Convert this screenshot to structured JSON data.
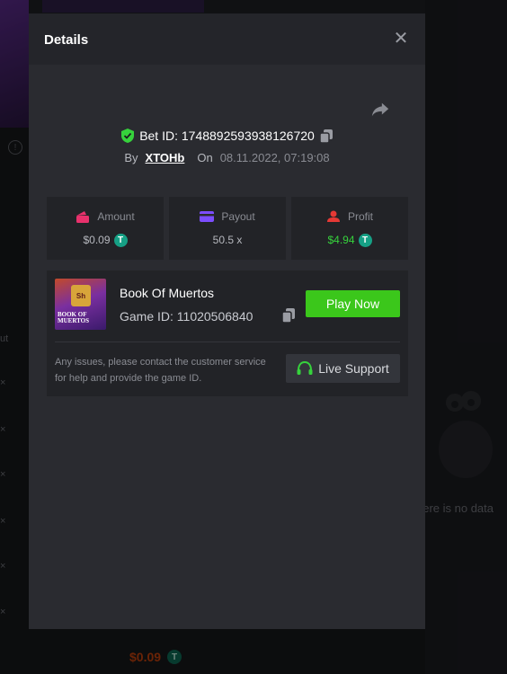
{
  "modal": {
    "title": "Details",
    "bet_id_label": "Bet ID: 1748892593938126720",
    "by_label": "By",
    "username": "XTOHb",
    "on_label": "On",
    "date": "08.11.2022, 07:19:08"
  },
  "stats": {
    "amount": {
      "label": "Amount",
      "value": "$0.09",
      "icon": "wallet-icon",
      "color": "#e8316c"
    },
    "payout": {
      "label": "Payout",
      "value": "50.5 x",
      "icon": "card-icon",
      "color": "#7c4dff"
    },
    "profit": {
      "label": "Profit",
      "value": "$4.94",
      "icon": "user-coin-icon",
      "color": "#e53935"
    }
  },
  "game": {
    "name": "Book Of Muertos",
    "id_label": "Game ID: 11020506840",
    "thumb_text": "BOOK OF MUERTOS",
    "thumb_badge": "Sh",
    "play_label": "Play Now",
    "issue_text": "Any issues, please contact the customer service for help and provide the game ID.",
    "support_label": "Live Support"
  },
  "background": {
    "no_data_text": "here is no data",
    "left_text": "ut",
    "bottom_amount": "$0.09"
  },
  "colors": {
    "accent_green": "#3bc71b",
    "profit_green": "#36d23c",
    "coin_teal": "#16a085"
  }
}
